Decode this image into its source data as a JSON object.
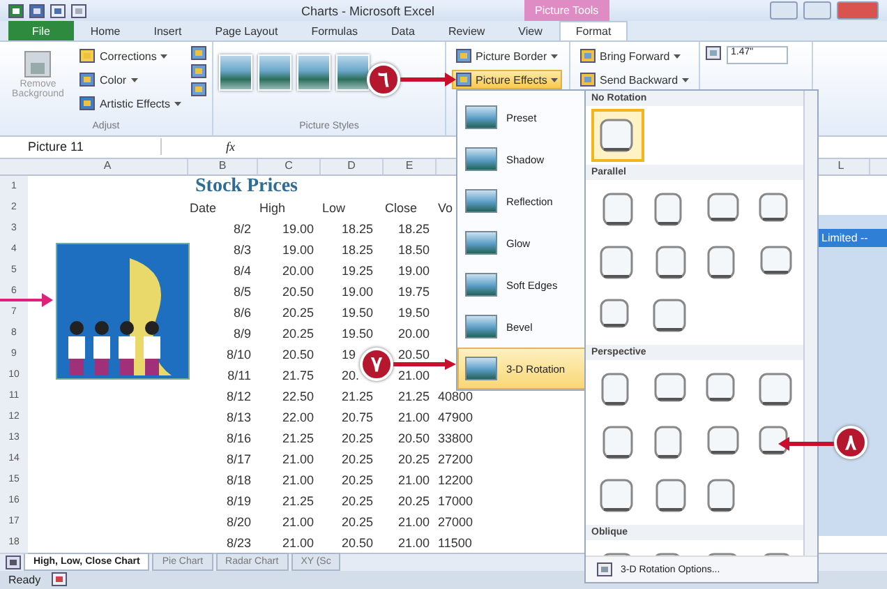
{
  "title_bar": {
    "title": "Charts - Microsoft Excel",
    "context_tab": "Picture Tools"
  },
  "tabs": [
    {
      "label": "File",
      "kind": "file",
      "selected": false
    },
    {
      "label": "Home",
      "kind": "tab",
      "selected": false
    },
    {
      "label": "Insert",
      "kind": "tab",
      "selected": false
    },
    {
      "label": "Page Layout",
      "kind": "tab",
      "selected": false
    },
    {
      "label": "Formulas",
      "kind": "tab",
      "selected": false
    },
    {
      "label": "Data",
      "kind": "tab",
      "selected": false
    },
    {
      "label": "Review",
      "kind": "tab",
      "selected": false
    },
    {
      "label": "View",
      "kind": "tab",
      "selected": false
    },
    {
      "label": "Format",
      "kind": "tab",
      "selected": true
    }
  ],
  "adjust": {
    "label": "Adjust",
    "big_button": "Remove Background",
    "buttons": [
      "Corrections",
      "Color",
      "Artistic Effects"
    ]
  },
  "picture_styles": {
    "label": "Picture Styles"
  },
  "effects_buttons": [
    {
      "label": "Picture Border",
      "open": false
    },
    {
      "label": "Picture Effects",
      "open": true
    }
  ],
  "arrange_buttons": [
    "Bring Forward",
    "Send Backward"
  ],
  "size": {
    "height": "1.47\""
  },
  "formula_bar": {
    "name_box": "Picture 11",
    "fx": "fx"
  },
  "columns": [
    "A",
    "B",
    "C",
    "D",
    "E"
  ],
  "far_column": "L",
  "row_numbers": [
    "1",
    "2",
    "3",
    "4",
    "5",
    "6",
    "7",
    "8",
    "9",
    "10",
    "11",
    "12",
    "13",
    "14",
    "15",
    "16",
    "17",
    "18"
  ],
  "sheet_title": "Stock Prices",
  "headers": [
    "Date",
    "High",
    "Low",
    "Close",
    "Vo"
  ],
  "rows": [
    {
      "date": "8/2",
      "high": "19.00",
      "low": "18.25",
      "close": "18.25"
    },
    {
      "date": "8/3",
      "high": "19.00",
      "low": "18.25",
      "close": "18.50"
    },
    {
      "date": "8/4",
      "high": "20.00",
      "low": "19.25",
      "close": "19.00"
    },
    {
      "date": "8/5",
      "high": "20.50",
      "low": "19.00",
      "close": "19.75"
    },
    {
      "date": "8/6",
      "high": "20.25",
      "low": "19.50",
      "close": "19.50"
    },
    {
      "date": "8/9",
      "high": "20.25",
      "low": "19.50",
      "close": "20.00"
    },
    {
      "date": "8/10",
      "high": "20.50",
      "low": "19",
      "close": "20.50"
    },
    {
      "date": "8/11",
      "high": "21.75",
      "low": "20.",
      "close": "21.00"
    },
    {
      "date": "8/12",
      "high": "22.50",
      "low": "21.25",
      "close": "21.25",
      "volume": "40800"
    },
    {
      "date": "8/13",
      "high": "22.00",
      "low": "20.75",
      "close": "21.00",
      "volume": "47900"
    },
    {
      "date": "8/16",
      "high": "21.25",
      "low": "20.25",
      "close": "20.50",
      "volume": "33800"
    },
    {
      "date": "8/17",
      "high": "21.00",
      "low": "20.25",
      "close": "20.25",
      "volume": "27200"
    },
    {
      "date": "8/18",
      "high": "21.00",
      "low": "20.25",
      "close": "21.00",
      "volume": "12200"
    },
    {
      "date": "8/19",
      "high": "21.25",
      "low": "20.25",
      "close": "20.25",
      "volume": "17000"
    },
    {
      "date": "8/20",
      "high": "21.00",
      "low": "20.25",
      "close": "21.00",
      "volume": "27000"
    },
    {
      "date": "8/23",
      "high": "21.00",
      "low": "20.50",
      "close": "21.00",
      "volume": "11500"
    }
  ],
  "chart_fragment": {
    "title": "Limited --"
  },
  "sheet_tabs": [
    {
      "label": "High, Low, Close Chart",
      "selected": true
    },
    {
      "label": "Pie Chart",
      "selected": false
    },
    {
      "label": "Radar Chart",
      "selected": false
    },
    {
      "label": "XY (Sc",
      "selected": false
    }
  ],
  "status": "Ready",
  "effects_menu": [
    {
      "label": "Preset",
      "selected": false
    },
    {
      "label": "Shadow",
      "selected": false
    },
    {
      "label": "Reflection",
      "selected": false
    },
    {
      "label": "Glow",
      "selected": false
    },
    {
      "label": "Soft Edges",
      "selected": false
    },
    {
      "label": "Bevel",
      "selected": false
    },
    {
      "label": "3-D Rotation",
      "selected": true
    }
  ],
  "rotation_gallery": {
    "sections": [
      {
        "title": "No Rotation",
        "presets": [
          {
            "selected": true
          }
        ]
      },
      {
        "title": "Parallel",
        "presets": [
          {
            "selected": false
          },
          {
            "selected": false
          },
          {
            "selected": false
          },
          {
            "selected": false
          },
          {
            "selected": false
          },
          {
            "selected": false
          },
          {
            "selected": false
          },
          {
            "selected": false
          },
          {
            "selected": false
          },
          {
            "selected": false
          }
        ]
      },
      {
        "title": "Perspective",
        "presets": [
          {
            "selected": false
          },
          {
            "selected": false
          },
          {
            "selected": false
          },
          {
            "selected": false
          },
          {
            "selected": false
          },
          {
            "selected": false
          },
          {
            "selected": false
          },
          {
            "selected": false
          },
          {
            "selected": false
          },
          {
            "selected": false
          },
          {
            "selected": false
          }
        ]
      },
      {
        "title": "Oblique",
        "presets": [
          {
            "selected": false
          },
          {
            "selected": false
          },
          {
            "selected": false
          },
          {
            "selected": false
          }
        ]
      }
    ],
    "footer": "3-D Rotation Options..."
  },
  "callouts": [
    {
      "label": "٦"
    },
    {
      "label": "٧"
    },
    {
      "label": "٨"
    }
  ]
}
